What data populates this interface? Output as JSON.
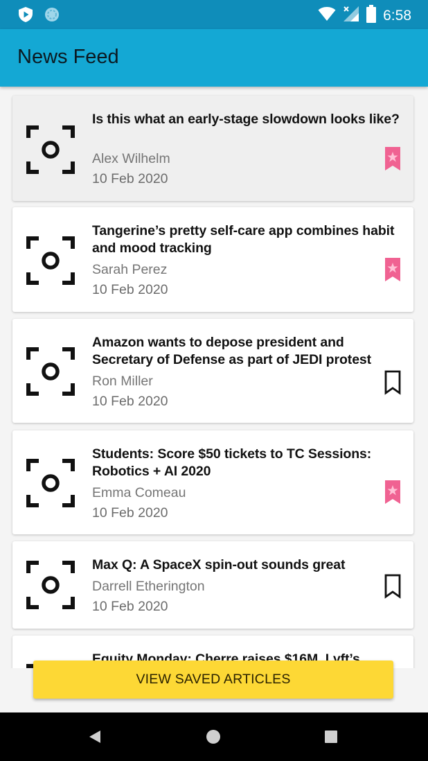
{
  "status_bar": {
    "time": "6:58",
    "icons": [
      "shield-icon",
      "sync-icon",
      "wifi-icon",
      "signal-off-icon",
      "battery-icon"
    ]
  },
  "app_bar": {
    "title": "News Feed"
  },
  "articles": [
    {
      "title": "Is this what an early-stage slowdown looks like?",
      "author": "Alex Wilhelm",
      "date": "10 Feb 2020",
      "bookmarked": true,
      "highlighted": true
    },
    {
      "title": "Tangerine’s pretty self-care app combines habit and mood tracking",
      "author": "Sarah Perez",
      "date": "10 Feb 2020",
      "bookmarked": true,
      "highlighted": false
    },
    {
      "title": "Amazon wants to depose president and Secretary of Defense as part of JEDI protest",
      "author": "Ron Miller",
      "date": "10 Feb 2020",
      "bookmarked": false,
      "highlighted": false
    },
    {
      "title": "Students: Score $50 tickets to TC Sessions: Robotics + AI 2020",
      "author": "Emma Comeau",
      "date": "10 Feb 2020",
      "bookmarked": true,
      "highlighted": false
    },
    {
      "title": "Max Q: A SpaceX spin-out sounds great",
      "author": "Darrell Etherington",
      "date": "10 Feb 2020",
      "bookmarked": false,
      "highlighted": false
    },
    {
      "title": "Equity Monday: Cherre raises $16M, Lyft’s",
      "author": "",
      "date": "",
      "bookmarked": false,
      "highlighted": false
    }
  ],
  "saved_button": {
    "label": "VIEW SAVED ARTICLES"
  },
  "colors": {
    "status_bar": "#0f8dba",
    "app_bar": "#14a8d4",
    "bookmark_active": "#f06292",
    "saved_button": "#fdd835"
  },
  "nav_bar": {
    "icons": [
      "back-icon",
      "home-icon",
      "recents-icon"
    ]
  }
}
